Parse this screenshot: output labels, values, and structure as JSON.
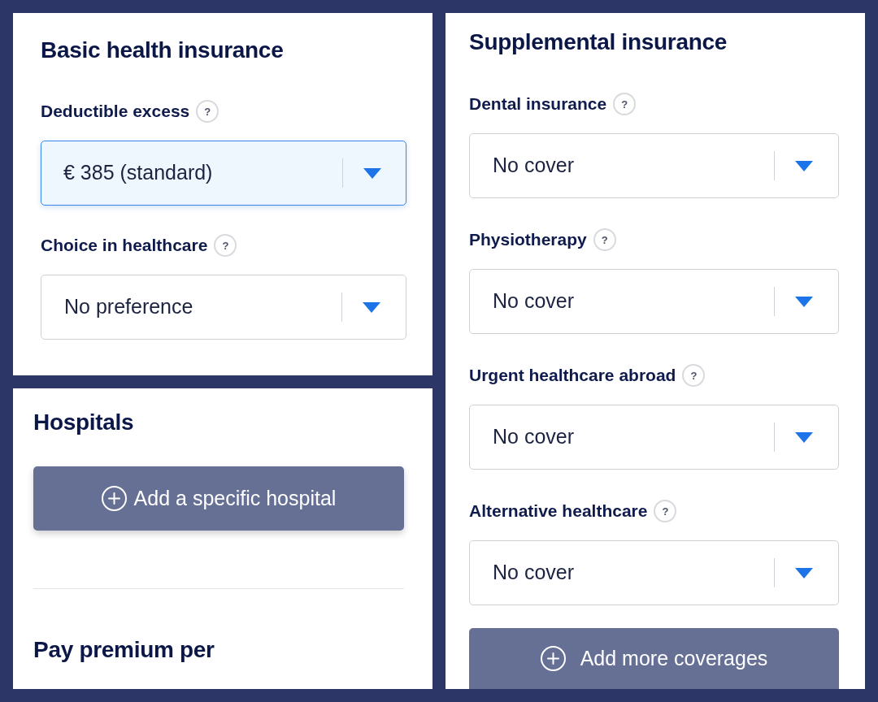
{
  "basic_health_insurance": {
    "title": "Basic health insurance",
    "fields": [
      {
        "label": "Deductible excess",
        "help": "?",
        "value": "€ 385 (standard)",
        "focused": true
      },
      {
        "label": "Choice in healthcare",
        "help": "?",
        "value": "No preference",
        "focused": false
      }
    ]
  },
  "hospitals": {
    "title": "Hospitals",
    "button": {
      "label": "Add a specific hospital"
    },
    "next_section": {
      "title": "Pay premium per"
    }
  },
  "supplemental_insurance": {
    "title": "Supplemental insurance",
    "fields": [
      {
        "label": "Dental insurance",
        "help": "?",
        "value": "No cover",
        "focused": false
      },
      {
        "label": "Physiotherapy",
        "help": "?",
        "value": "No cover",
        "focused": false
      },
      {
        "label": "Urgent healthcare abroad",
        "help": "?",
        "value": "No cover",
        "focused": false
      },
      {
        "label": "Alternative healthcare",
        "help": "?",
        "value": "No cover",
        "focused": false
      }
    ],
    "button": {
      "label": "Add more coverages"
    }
  }
}
